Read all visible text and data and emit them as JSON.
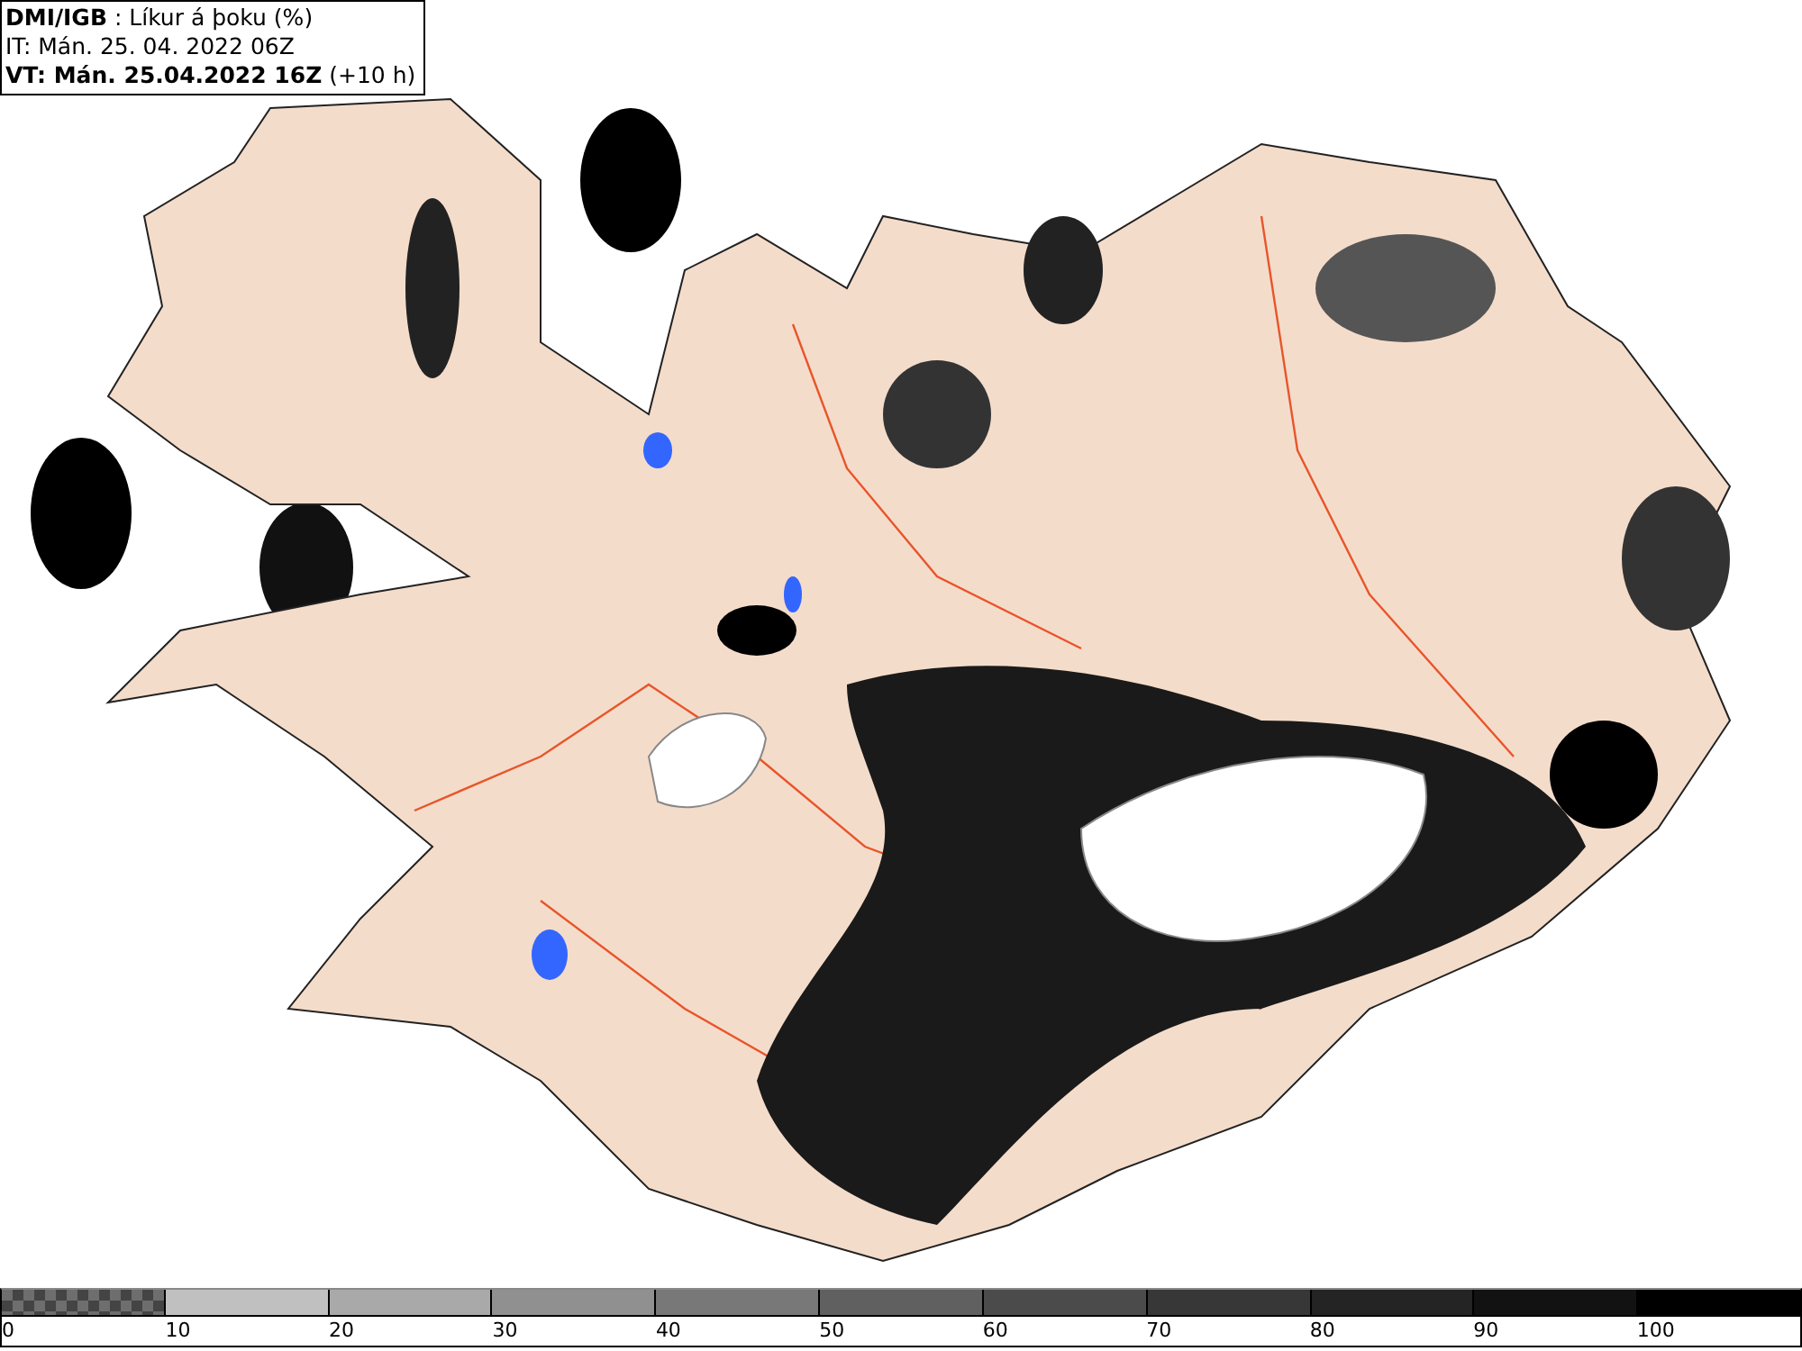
{
  "header": {
    "lines": [
      "**DMI/IGB** : Líkur á þoku (%)",
      "IT: Mán. 25. 04. 2022 06Z",
      "**VT: Mán. 25.04.2022 16Z** (+10 h)"
    ]
  },
  "legend": {
    "bins": [
      {
        "label": "0",
        "kind": "checker",
        "color": "#6e6e6e"
      },
      {
        "label": "10",
        "kind": "solid",
        "color": "#c0c0c0"
      },
      {
        "label": "20",
        "kind": "solid",
        "color": "#a9a9a9"
      },
      {
        "label": "30",
        "kind": "solid",
        "color": "#909090"
      },
      {
        "label": "40",
        "kind": "solid",
        "color": "#787878"
      },
      {
        "label": "50",
        "kind": "solid",
        "color": "#606060"
      },
      {
        "label": "60",
        "kind": "solid",
        "color": "#4b4b4b"
      },
      {
        "label": "70",
        "kind": "solid",
        "color": "#373737"
      },
      {
        "label": "80",
        "kind": "solid",
        "color": "#242424"
      },
      {
        "label": "90",
        "kind": "solid",
        "color": "#121212"
      },
      {
        "label": "100",
        "kind": "solid",
        "color": "#000000"
      }
    ]
  }
}
